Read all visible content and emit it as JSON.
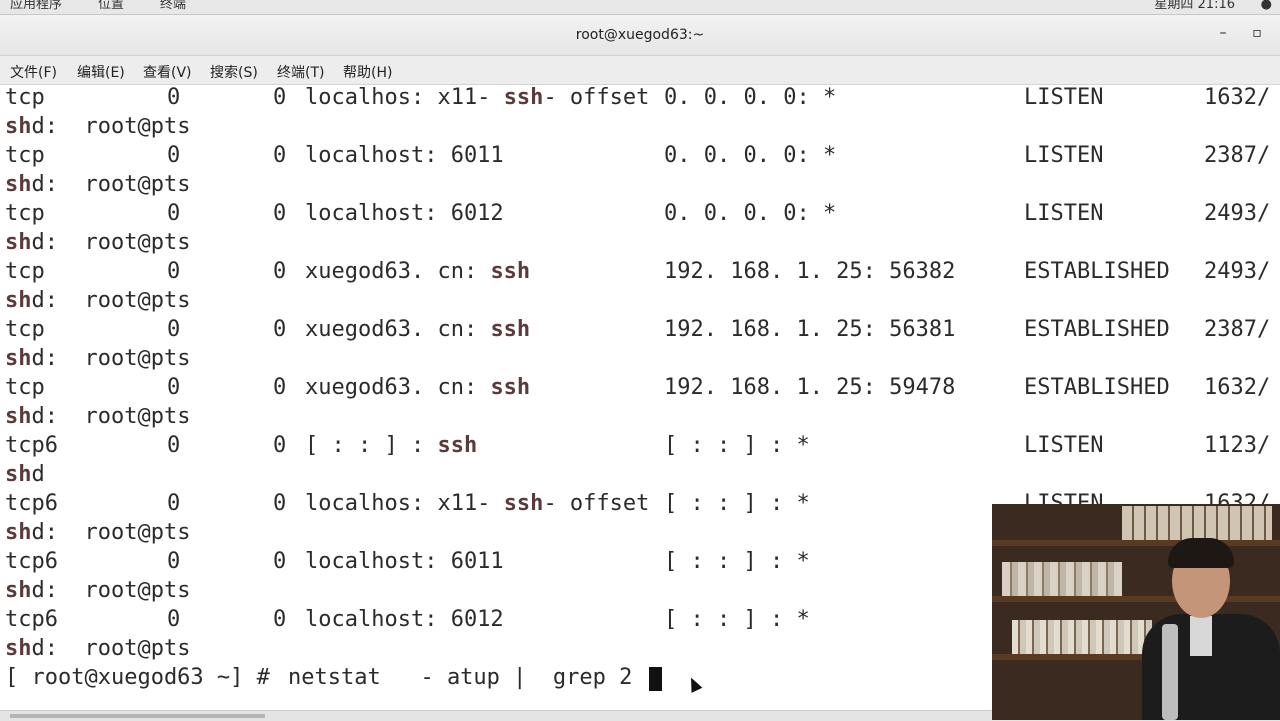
{
  "topbar": {
    "menu": [
      "应用程序",
      "位置",
      "终端"
    ],
    "clock": "星期四 21:16",
    "indicator": "●"
  },
  "window": {
    "title": "root@xuegod63:~",
    "minimize_label": "–",
    "maximize_label": "▫"
  },
  "menubar": [
    "文件(F)",
    "编辑(E)",
    "查看(V)",
    "搜索(S)",
    "终端(T)",
    "帮助(H)"
  ],
  "terminal": {
    "rows": [
      {
        "proto": "tcp",
        "recv": "0",
        "send": "0",
        "local_pre": "localhos: x11- ",
        "local_bold": "ssh",
        "local_post": "- offset",
        "foreign": "0. 0. 0. 0: *",
        "state": "LISTEN",
        "pid": "1632/",
        "prog_bold": "sh",
        "prog_rest": "d:  root@pts"
      },
      {
        "proto": "tcp",
        "recv": "0",
        "send": "0",
        "local_pre": "localhost: 6011",
        "local_bold": "",
        "local_post": "",
        "foreign": "0. 0. 0. 0: *",
        "state": "LISTEN",
        "pid": "2387/",
        "prog_bold": "sh",
        "prog_rest": "d:  root@pts"
      },
      {
        "proto": "tcp",
        "recv": "0",
        "send": "0",
        "local_pre": "localhost: 6012",
        "local_bold": "",
        "local_post": "",
        "foreign": "0. 0. 0. 0: *",
        "state": "LISTEN",
        "pid": "2493/",
        "prog_bold": "sh",
        "prog_rest": "d:  root@pts"
      },
      {
        "proto": "tcp",
        "recv": "0",
        "send": "0",
        "local_pre": "xuegod63. cn: ",
        "local_bold": "ssh",
        "local_post": "",
        "foreign": "192. 168. 1. 25: 56382",
        "state": "ESTABLISHED",
        "pid": "2493/",
        "prog_bold": "sh",
        "prog_rest": "d:  root@pts"
      },
      {
        "proto": "tcp",
        "recv": "0",
        "send": "0",
        "local_pre": "xuegod63. cn: ",
        "local_bold": "ssh",
        "local_post": "",
        "foreign": "192. 168. 1. 25: 56381",
        "state": "ESTABLISHED",
        "pid": "2387/",
        "prog_bold": "sh",
        "prog_rest": "d:  root@pts"
      },
      {
        "proto": "tcp",
        "recv": "0",
        "send": "0",
        "local_pre": "xuegod63. cn: ",
        "local_bold": "ssh",
        "local_post": "",
        "foreign": "192. 168. 1. 25: 59478",
        "state": "ESTABLISHED",
        "pid": "1632/",
        "prog_bold": "sh",
        "prog_rest": "d:  root@pts"
      },
      {
        "proto": "tcp6",
        "recv": "0",
        "send": "0",
        "local_pre": "[ : : ] : ",
        "local_bold": "ssh",
        "local_post": "",
        "foreign": "[ : : ] : *",
        "state": "LISTEN",
        "pid": "1123/",
        "prog_bold": "sh",
        "prog_rest": "d"
      },
      {
        "proto": "tcp6",
        "recv": "0",
        "send": "0",
        "local_pre": "localhos: x11- ",
        "local_bold": "ssh",
        "local_post": "- offset",
        "foreign": "[ : : ] : *",
        "state": "LISTEN",
        "pid": "1632/",
        "prog_bold": "sh",
        "prog_rest": "d:  root@pts"
      },
      {
        "proto": "tcp6",
        "recv": "0",
        "send": "0",
        "local_pre": "localhost: 6011",
        "local_bold": "",
        "local_post": "",
        "foreign": "[ : : ] : *",
        "state": "",
        "pid": "",
        "prog_bold": "sh",
        "prog_rest": "d:  root@pts"
      },
      {
        "proto": "tcp6",
        "recv": "0",
        "send": "0",
        "local_pre": "localhost: 6012",
        "local_bold": "",
        "local_post": "",
        "foreign": "[ : : ] : *",
        "state": "",
        "pid": "",
        "prog_bold": "sh",
        "prog_rest": "d:  root@pts"
      }
    ],
    "prompt": "[ root@xuegod63 ~] # ",
    "command": "netstat   - atup |  grep 2"
  },
  "colors": {
    "terminal_bg": "#ffffff",
    "terminal_fg": "#2b2b2b",
    "bold_fg": "#5a3a3a"
  }
}
